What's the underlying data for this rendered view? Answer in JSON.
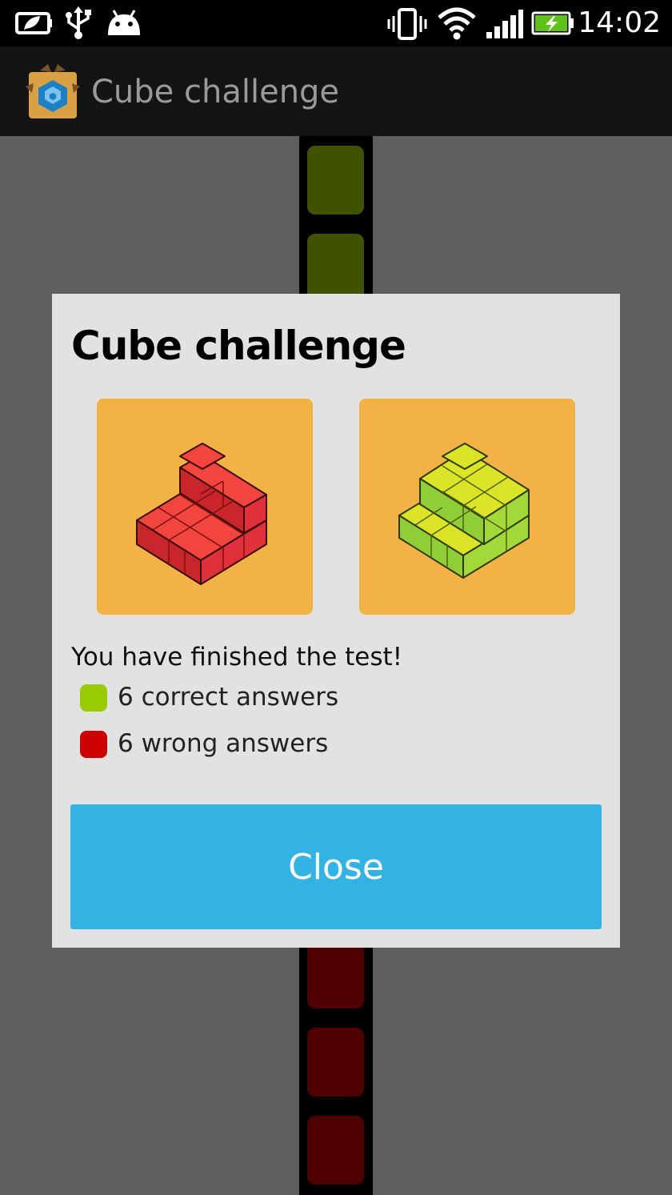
{
  "status_bar": {
    "time": "14:02",
    "left_icons": [
      "battery-saver-icon",
      "usb-icon",
      "android-debug-icon"
    ],
    "right_icons": [
      "vibrate-icon",
      "wifi-icon",
      "signal-icon",
      "battery-charging-icon"
    ]
  },
  "action_bar": {
    "title": "Cube challenge",
    "icon": "app-cube-icon"
  },
  "film_strip": {
    "colors": {
      "correct": "#3f5200",
      "wrong": "#4e0000"
    }
  },
  "dialog": {
    "title": "Cube challenge",
    "images": [
      {
        "name": "red-cube-figure",
        "color": "#e8403a"
      },
      {
        "name": "green-cube-figure",
        "color": "#c6dc2c"
      }
    ],
    "message": "You have finished the test!",
    "results": [
      {
        "label": "6 correct answers",
        "color": "#99cc00"
      },
      {
        "label": "6 wrong answers",
        "color": "#cc0000"
      }
    ],
    "close_label": "Close",
    "button_color": "#33b3e3"
  }
}
